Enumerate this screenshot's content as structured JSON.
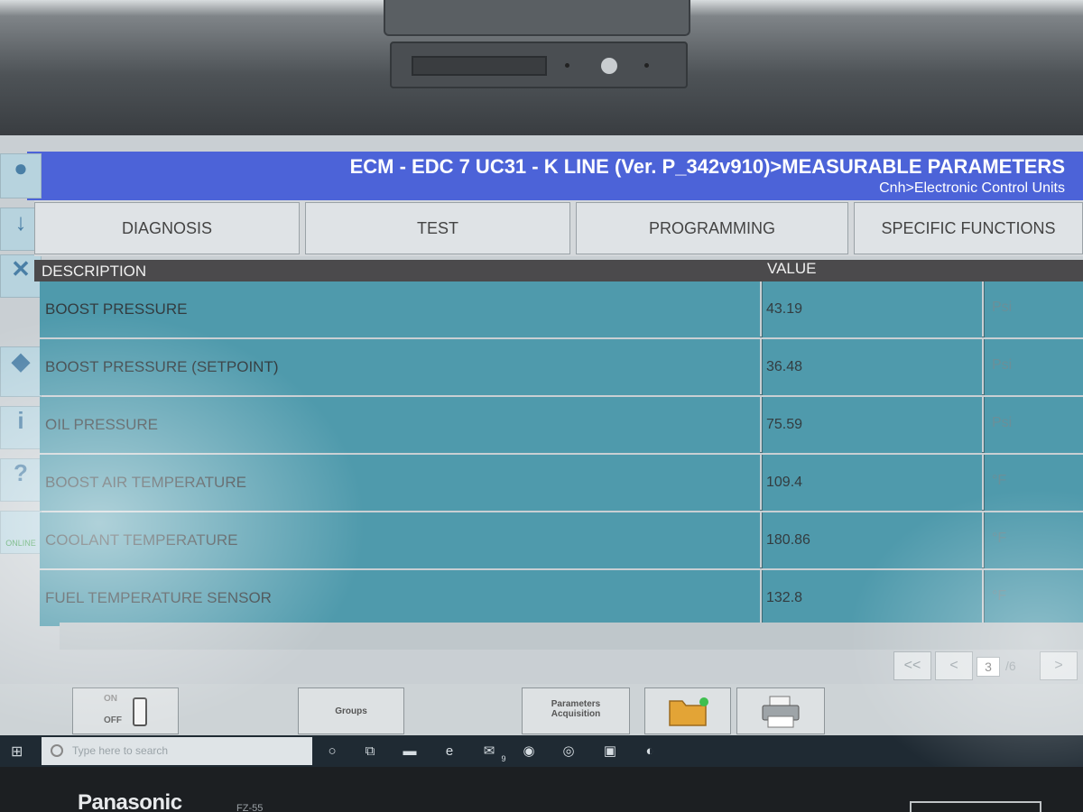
{
  "device": {
    "brand": "Panasonic",
    "model": "FZ-55"
  },
  "header": {
    "title": "ECM - EDC 7 UC31 - K LINE (Ver. P_342v910)>MEASURABLE PARAMETERS",
    "breadcrumb": "Cnh>Electronic Control Units"
  },
  "rail": {
    "online_label": "ONLINE"
  },
  "tabs": [
    {
      "label": "DIAGNOSIS"
    },
    {
      "label": "TEST"
    },
    {
      "label": "PROGRAMMING"
    },
    {
      "label": "SPECIFIC FUNCTIONS"
    }
  ],
  "table": {
    "headers": {
      "description": "DESCRIPTION",
      "value": "VALUE"
    },
    "rows": [
      {
        "description": "BOOST PRESSURE",
        "value": "43.19",
        "unit": "Psi"
      },
      {
        "description": "BOOST PRESSURE (SETPOINT)",
        "value": "36.48",
        "unit": "Psi"
      },
      {
        "description": "OIL PRESSURE",
        "value": "75.59",
        "unit": "Psi"
      },
      {
        "description": "BOOST AIR TEMPERATURE",
        "value": "109.4",
        "unit": "°F"
      },
      {
        "description": "COOLANT TEMPERATURE",
        "value": "180.86",
        "unit": "°F"
      },
      {
        "description": "FUEL TEMPERATURE SENSOR",
        "value": "132.8",
        "unit": "°F"
      }
    ]
  },
  "pager": {
    "first": "<<",
    "prev": "<",
    "current_page": "3",
    "total": "/6",
    "next": ">"
  },
  "toolbar": {
    "on_label": "ON",
    "off_label": "OFF",
    "groups_label": "Groups",
    "params_label": "Parameters Acquisition"
  },
  "taskbar": {
    "search_placeholder": "Type here to search",
    "mail_badge": "9"
  }
}
